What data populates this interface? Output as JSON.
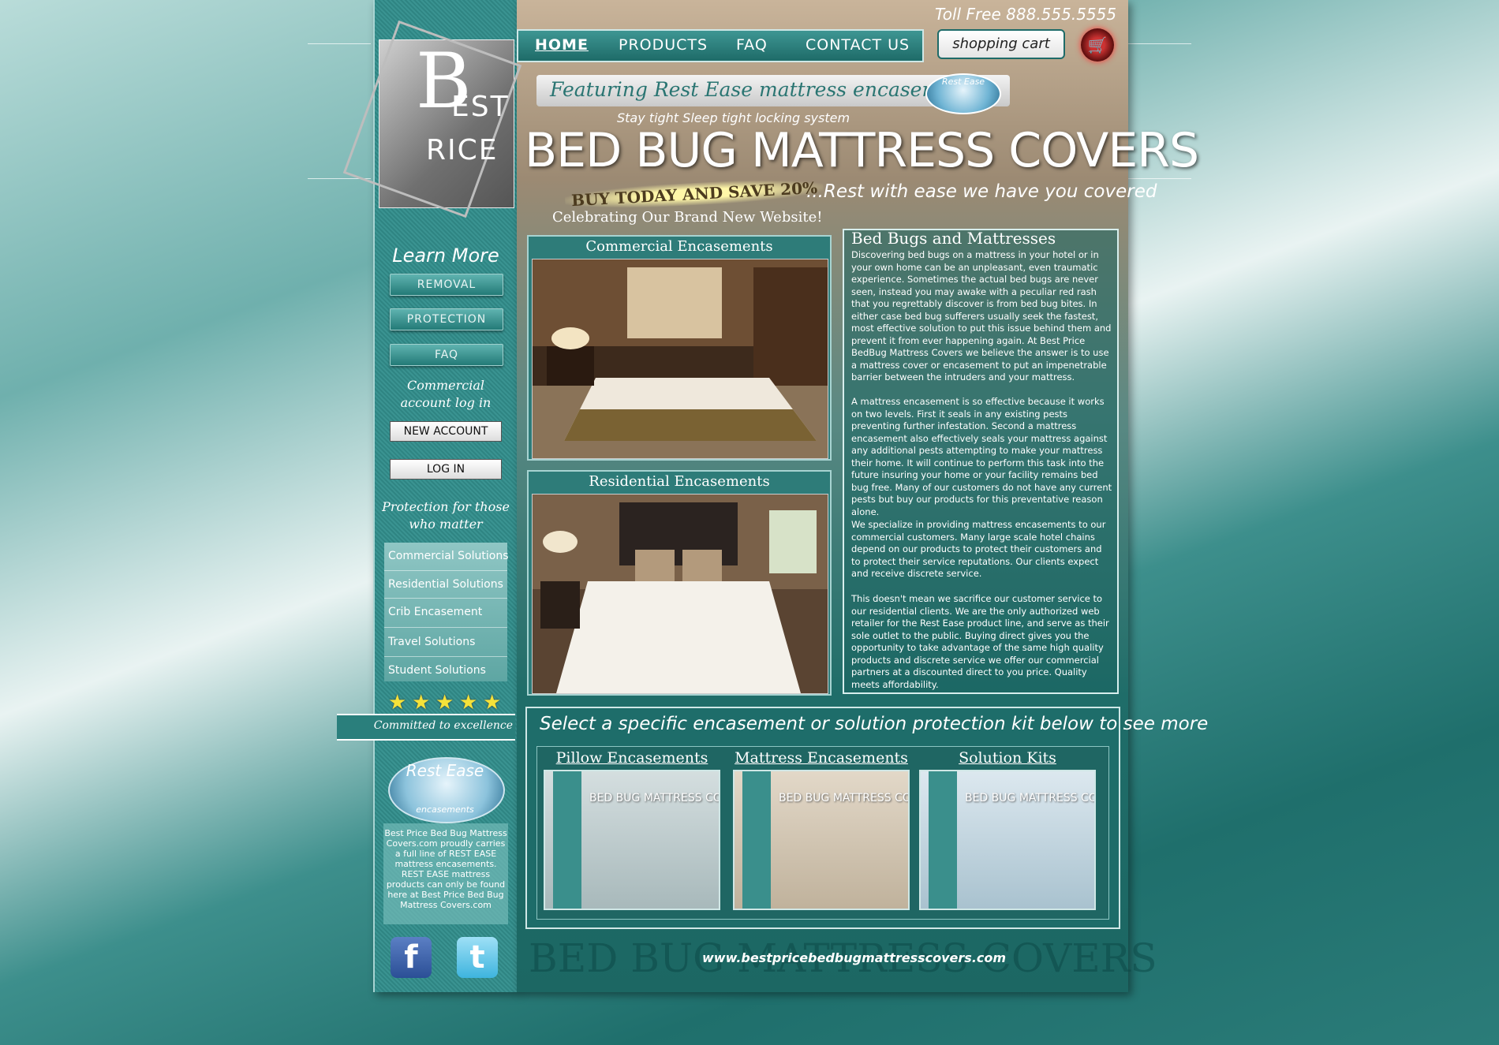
{
  "header": {
    "toll_free": "Toll Free   888.555.5555",
    "nav": [
      "HOME",
      "PRODUCTS",
      "FAQ",
      "CONTACT US"
    ],
    "cart_label": "shopping cart",
    "cart_icon": "cart-icon"
  },
  "logo": {
    "b": "B",
    "est": "EST",
    "rice": "RICE"
  },
  "hero": {
    "featuring": "Featuring Rest Ease mattress encasements",
    "badge": "Rest Ease",
    "small_tagline": "Stay tight Sleep tight locking system",
    "title": "BED BUG MATTRESS COVERS",
    "buy_today": "BUY TODAY AND SAVE 20%",
    "celebrate": "Celebrating Our Brand New Website!",
    "slogan": "...Rest with ease we have you covered"
  },
  "sidebar": {
    "learn_more": "Learn More",
    "buttons": [
      "REMOVAL",
      "PROTECTION",
      "FAQ"
    ],
    "commercial_login": "Commercial account log in",
    "new_account": "NEW ACCOUNT",
    "log_in": "LOG IN",
    "protection_heading": "Protection for those who matter",
    "solutions": [
      "Commercial Solutions",
      "Residential Solutions",
      "Crib Encasement",
      "Travel Solutions",
      "Student Solutions"
    ],
    "stars": 5,
    "ribbon": "Committed to excellence",
    "rest_ease": "Rest Ease",
    "rest_ease_sub": "encasements",
    "info": "Best Price Bed Bug Mattress Covers.com proudly carries a full line of REST EASE mattress encasements. REST EASE mattress products can only be found here at Best Price Bed Bug Mattress Covers.com",
    "social": [
      "facebook-icon",
      "twitter-icon"
    ],
    "facebook_glyph": "f",
    "twitter_glyph": "t"
  },
  "panels": [
    {
      "title": "Commercial Encasements"
    },
    {
      "title": "Residential Encasements"
    }
  ],
  "article": {
    "title": "Bed Bugs and Mattresses",
    "paragraphs": [
      "Discovering bed bugs on a mattress in your hotel or in your own home can be an unpleasant, even traumatic experience. Sometimes the actual bed bugs are never seen, instead you may awake with a peculiar red rash that you regrettably discover is from bed bug bites. In either case bed bug sufferers usually seek the fastest, most effective solution to put this issue behind them and prevent it from ever happening again. At Best Price BedBug Mattress Covers we believe the answer is to use a mattress cover or encasement to put an impenetrable barrier between the intruders  and your mattress.",
      "A mattress encasement is so effective because it works on two levels. First it seals in any existing pests preventing further infestation. Second a mattress encasement also effectively seals your mattress against any additional pests attempting to make your mattress their home. It will continue to perform this task into the future insuring your home or your facility remains bed bug free. Many of our customers do not have any current pests but buy our products for this preventative reason alone.",
      "We specialize in providing mattress encasements to our commercial customers. Many large scale hotel chains depend on our products to protect their customers and to protect their service reputations.  Our clients expect and receive discrete service.",
      "This doesn't mean we sacrifice our customer service to our residential clients. We are the only authorized web retailer for the Rest Ease product line, and serve as their sole outlet to the public. Buying direct gives you the opportunity to take advantage of the same high quality products and discrete service we offer our commercial partners at a discounted direct to you price. Quality meets affordability."
    ]
  },
  "bottom": {
    "select_text": "Select a specific encasement or solution protection kit below to see more",
    "kits": [
      {
        "title": "Pillow Encasements",
        "thumb": "BED BUG MATTRESS COVERS"
      },
      {
        "title": "Mattress Encasements",
        "thumb": "BED BUG MATTRESS COVERS"
      },
      {
        "title": "Solution Kits",
        "thumb": "BED BUG MATTRESS COVERS"
      }
    ]
  },
  "footer": {
    "ghost": "BED BUG MATTRESS COVERS",
    "url": "www.bestpricebedbugmattresscovers.com"
  },
  "colors": {
    "teal": "#1f6d69",
    "accent": "#f5e23a",
    "cart_red": "#c33"
  }
}
